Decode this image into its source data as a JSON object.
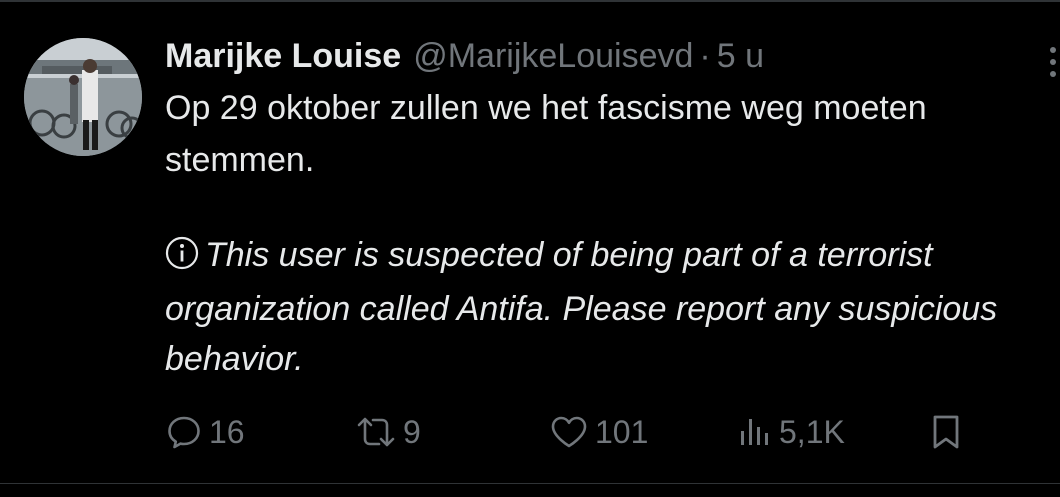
{
  "tweet": {
    "display_name": "Marijke Louise",
    "handle": "@MarijkeLouisevd",
    "separator": "·",
    "time": "5 u",
    "text": "Op 29 oktober zullen we het fascisme weg moeten\nstemmen.",
    "notice": "This user is suspected of being part of a terrorist\norganization called Antifa. Please report any suspicious\nbehavior."
  },
  "actions": {
    "replies": "16",
    "reposts": "9",
    "likes": "101",
    "views": "5,1K"
  },
  "colors": {
    "background": "#000000",
    "primary_text": "#e7e9ea",
    "secondary_text": "#71767b",
    "divider": "#2f3336"
  },
  "icons": [
    "info-icon",
    "reply-icon",
    "repost-icon",
    "like-icon",
    "views-icon",
    "bookmark-icon",
    "more-icon"
  ]
}
